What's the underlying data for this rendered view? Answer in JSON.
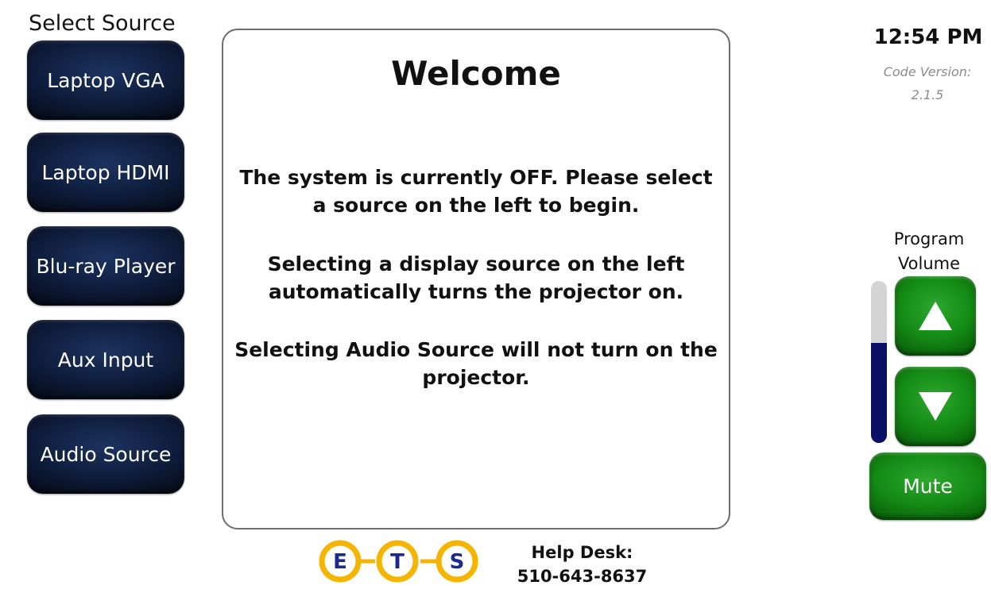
{
  "sources": {
    "title": "Select Source",
    "buttons": [
      {
        "label": "Laptop VGA"
      },
      {
        "label": "Laptop HDMI"
      },
      {
        "label": "Blu-ray Player"
      },
      {
        "label": "Aux Input"
      },
      {
        "label": "Audio Source"
      }
    ]
  },
  "welcome": {
    "title": "Welcome",
    "messages": [
      {
        "lines": [
          "The system is currently OFF. Please select",
          "a source on the left to begin."
        ]
      },
      {
        "lines": [
          "Selecting a display source on the left",
          "automatically turns the projector on."
        ]
      },
      {
        "lines": [
          "Selecting Audio Source will not turn on the",
          "projector."
        ]
      }
    ]
  },
  "status": {
    "time": "12:54 PM",
    "code_version_label": "Code Version:",
    "code_version": "2.1.5"
  },
  "volume": {
    "label_line1": "Program",
    "label_line2": "Volume",
    "level_fraction": 0.62,
    "up_icon": "triangle-up-icon",
    "down_icon": "triangle-down-icon",
    "mute_label": "Mute"
  },
  "footer": {
    "logo_letters": [
      "E",
      "T",
      "S"
    ],
    "help_desk_label": "Help Desk:",
    "help_desk_phone": "510-643-8637"
  },
  "colors": {
    "source_button": "#0e1c3a",
    "control_green": "#148a14",
    "volume_fill": "#0b1066",
    "logo_ring": "#f4b400",
    "logo_letter": "#1b2a8c"
  }
}
